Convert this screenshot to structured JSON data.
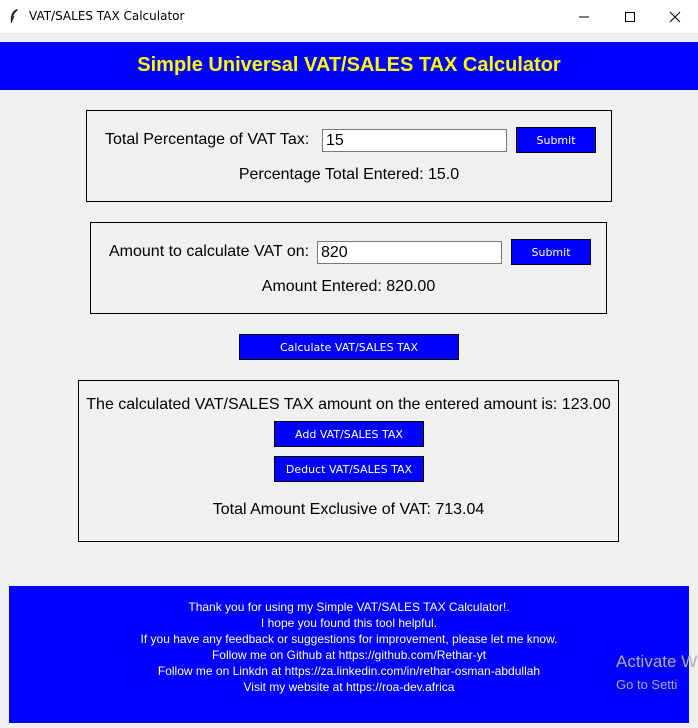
{
  "window": {
    "title": "VAT/SALES TAX Calculator",
    "controls": {
      "minimize": "minimize-icon",
      "maximize": "maximize-icon",
      "close": "close-icon"
    }
  },
  "header": {
    "title": "Simple Universal VAT/SALES TAX Calculator"
  },
  "vat_section": {
    "label": "Total Percentage of VAT Tax:",
    "input_value": "15",
    "submit_label": "Submit",
    "status": "Percentage Total Entered: 15.0"
  },
  "amount_section": {
    "label": "Amount to calculate VAT on:",
    "input_value": "820",
    "submit_label": "Submit",
    "status": "Amount Entered: 820.00"
  },
  "calculate_button": "Calculate VAT/SALES TAX",
  "result_section": {
    "result_text": "The calculated VAT/SALES TAX amount on the entered amount is: 123.00",
    "add_button": "Add VAT/SALES TAX",
    "deduct_button": "Deduct VAT/SALES TAX",
    "total_text": "Total Amount Exclusive of VAT: 713.04"
  },
  "footer": {
    "lines": [
      "Thank you for using my Simple VAT/SALES TAX Calculator!.",
      "I hope you found this tool helpful.",
      "If you have any feedback or suggestions for improvement, please let me know.",
      "Follow me on Github at https://github.com/Rethar-yt",
      "Follow me on Linkdn at https://za.linkedin.com/in/rethar-osman-abdullah",
      "Visit my website at https://roa-dev.africa"
    ]
  },
  "watermark": {
    "line1": "Activate W",
    "line2": "Go to Setti"
  },
  "colors": {
    "accent": "#0000ff",
    "header_text": "#ffff00",
    "background": "#f0f0f0"
  }
}
